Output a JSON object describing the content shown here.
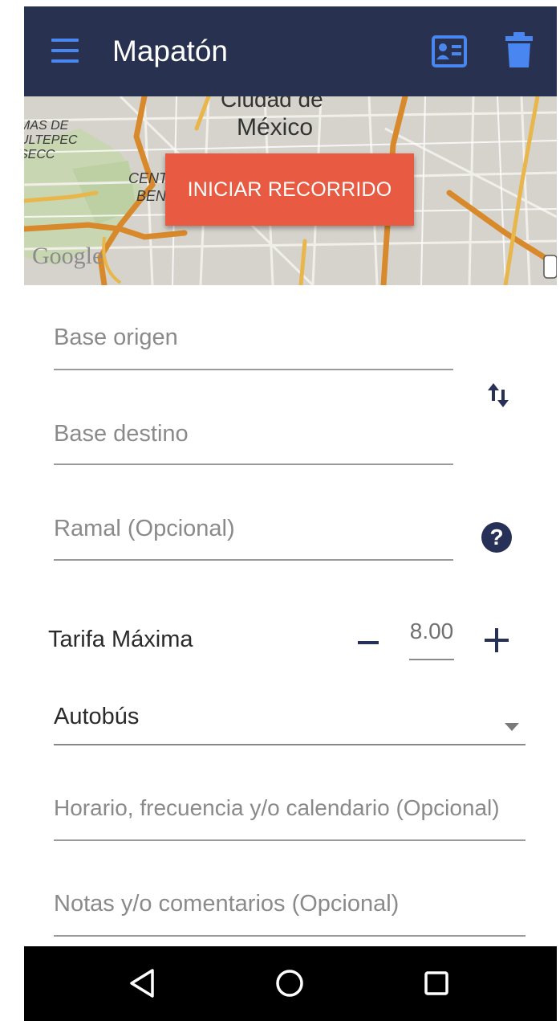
{
  "app": {
    "title": "Mapatón"
  },
  "map": {
    "labels": {
      "city_partial": "Ciudad de",
      "city": "México",
      "left_1": "MAS DE",
      "left_2": "ULTEPEC",
      "left_3": "SECC",
      "center_1": "CENT",
      "center_2": "BEN",
      "google": "Google"
    },
    "start_button": "INICIAR RECORRIDO"
  },
  "form": {
    "origin_placeholder": "Base origen",
    "destination_placeholder": "Base destino",
    "branch_placeholder": "Ramal (Opcional)",
    "fare_label": "Tarifa Máxima",
    "fare_value": "8.00",
    "vehicle_value": "Autobús",
    "schedule_placeholder": "Horario, frecuencia y/o calendario (Opcional)",
    "notes_placeholder": "Notas y/o comentarios (Opcional)"
  },
  "icons": {
    "menu": "menu-icon",
    "card": "contact-card-icon",
    "trash": "trash-icon",
    "swap": "swap-vertical-icon",
    "help": "help-icon",
    "help_glyph": "?",
    "back": "back-triangle-icon",
    "home": "home-circle-icon",
    "recents": "recents-square-icon"
  },
  "colors": {
    "appbar": "#283150",
    "accent_blue": "#4a86f0",
    "start_button": "#e85a41",
    "icon_dark": "#273157"
  }
}
